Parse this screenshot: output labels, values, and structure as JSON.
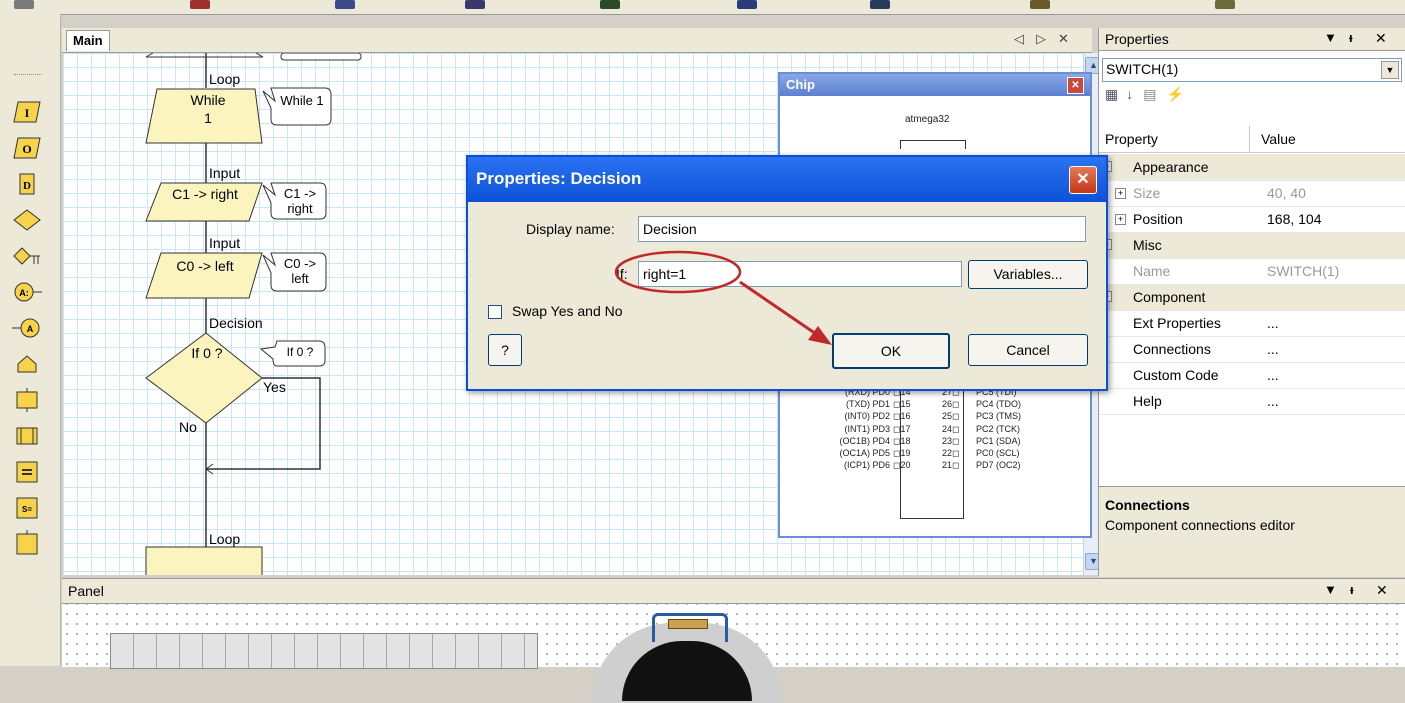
{
  "editor": {
    "tab_label": "Main",
    "nav_prev": "◁",
    "nav_next": "▷",
    "close": "✕"
  },
  "flowchart": {
    "loop_top_label": "Loop",
    "while_shape": "While\n1",
    "while_comment": "While 1",
    "input1_label": "Input",
    "input1_shape": "C1 -> right",
    "input1_comment": "C1 -> right",
    "input2_label": "Input",
    "input2_shape": "C0 -> left",
    "input2_comment": "C0 -> left",
    "decision_label": "Decision",
    "decision_shape": "If 0 ?",
    "decision_comment": "If 0 ?",
    "yes_label": "Yes",
    "no_label": "No",
    "loop_bottom_label": "Loop"
  },
  "chip": {
    "title": "Chip",
    "name": "atmega32",
    "pins_left": [
      "(RXD) PD0",
      "(TXD) PD1",
      "(INT0) PD2",
      "(INT1) PD3",
      "(OC1B) PD4",
      "(OC1A) PD5",
      "(ICP1) PD6"
    ],
    "pins_left_num": [
      "14",
      "15",
      "16",
      "17",
      "18",
      "19",
      "20"
    ],
    "pins_right_num": [
      "27",
      "26",
      "25",
      "24",
      "23",
      "22",
      "21"
    ],
    "pins_right": [
      "PC5 (TDI)",
      "PC4 (TDO)",
      "PC3 (TMS)",
      "PC2 (TCK)",
      "PC1 (SDA)",
      "PC0 (SCL)",
      "PD7 (OC2)"
    ]
  },
  "properties": {
    "header": "Properties",
    "selected_object": "SWITCH(1)",
    "col_property": "Property",
    "col_value": "Value",
    "rows": [
      {
        "kind": "category",
        "name": "Appearance"
      },
      {
        "kind": "item",
        "name": "Size",
        "value": "40, 40",
        "disabled": true
      },
      {
        "kind": "item",
        "name": "Position",
        "value": "168, 104",
        "disabled": false
      },
      {
        "kind": "category",
        "name": "Misc"
      },
      {
        "kind": "item",
        "name": "Name",
        "value": "SWITCH(1)",
        "disabled": true
      },
      {
        "kind": "category",
        "name": "Component"
      },
      {
        "kind": "item",
        "name": "Ext Properties",
        "value": "...",
        "disabled": false
      },
      {
        "kind": "item",
        "name": "Connections",
        "value": "...",
        "disabled": false
      },
      {
        "kind": "item",
        "name": "Custom Code",
        "value": "...",
        "disabled": false
      },
      {
        "kind": "item",
        "name": "Help",
        "value": "...",
        "disabled": false
      }
    ],
    "help_title": "Connections",
    "help_text": "Component connections editor"
  },
  "panel": {
    "title": "Panel"
  },
  "dialog": {
    "title": "Properties: Decision",
    "display_name_label": "Display name:",
    "display_name_value": "Decision",
    "if_label": "If:",
    "if_value": "right=1",
    "variables_button": "Variables...",
    "swap_label": "Swap Yes and No",
    "help_button": "?",
    "ok_button": "OK",
    "cancel_button": "Cancel"
  },
  "colors": {
    "annotation": "#c0282a",
    "flow_fill": "#fbf4bf",
    "dialog_title": "#0d52d6"
  }
}
